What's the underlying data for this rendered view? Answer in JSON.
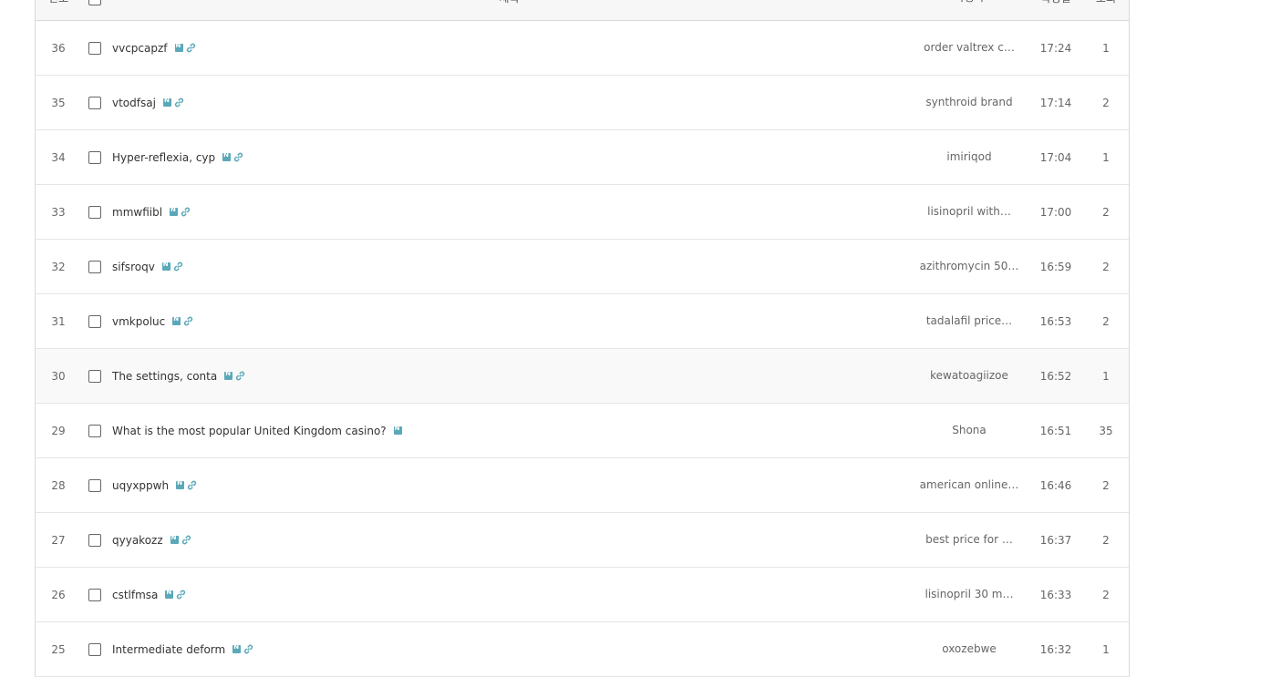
{
  "header": {
    "num": "번호",
    "title": "제목",
    "author": "작성자",
    "date": "작성일",
    "views": "조회"
  },
  "posts": [
    {
      "num": "36",
      "title": "vvcpcapzf",
      "author": "order valtrex c…",
      "date": "17:24",
      "views": "1",
      "link": true
    },
    {
      "num": "35",
      "title": "vtodfsaj",
      "author": "synthroid brand",
      "date": "17:14",
      "views": "2",
      "link": true
    },
    {
      "num": "34",
      "title": "Hyper-reflexia, cyp",
      "author": "imiriqod",
      "date": "17:04",
      "views": "1",
      "link": true
    },
    {
      "num": "33",
      "title": "mmwfiibl",
      "author": "lisinopril with…",
      "date": "17:00",
      "views": "2",
      "link": true
    },
    {
      "num": "32",
      "title": "sifsroqv",
      "author": "azithromycin 50…",
      "date": "16:59",
      "views": "2",
      "link": true
    },
    {
      "num": "31",
      "title": "vmkpoluc",
      "author": "tadalafil price…",
      "date": "16:53",
      "views": "2",
      "link": true
    },
    {
      "num": "30",
      "title": "The settings, conta",
      "author": "kewatoagiizoe",
      "date": "16:52",
      "views": "1",
      "link": true
    },
    {
      "num": "29",
      "title": "What is the most popular United Kingdom casino?",
      "author": "Shona",
      "date": "16:51",
      "views": "35",
      "link": false
    },
    {
      "num": "28",
      "title": "uqyxppwh",
      "author": "american online…",
      "date": "16:46",
      "views": "2",
      "link": true
    },
    {
      "num": "27",
      "title": "qyyakozz",
      "author": "best price for …",
      "date": "16:37",
      "views": "2",
      "link": true
    },
    {
      "num": "26",
      "title": "cstlfmsa",
      "author": "lisinopril 30 m…",
      "date": "16:33",
      "views": "2",
      "link": true
    },
    {
      "num": "25",
      "title": "Intermediate deform",
      "author": "oxozebwe",
      "date": "16:32",
      "views": "1",
      "link": true
    }
  ]
}
